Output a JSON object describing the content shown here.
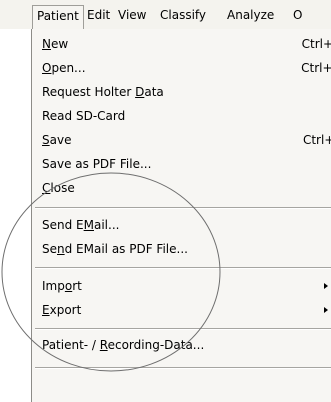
{
  "menubar": {
    "items": [
      {
        "label": "Patient"
      },
      {
        "label": "Edit"
      },
      {
        "label": "View"
      },
      {
        "label": "Classify"
      },
      {
        "label": "Analyze"
      },
      {
        "label": "O"
      }
    ]
  },
  "menu": {
    "new": {
      "pre": "",
      "mn": "N",
      "post": "ew",
      "shortcut": "Ctrl+N"
    },
    "open": {
      "pre": "",
      "mn": "O",
      "post": "pen...",
      "shortcut": "Ctrl+O"
    },
    "request": {
      "pre": "Request Holter ",
      "mn": "D",
      "post": "ata"
    },
    "read": {
      "label": "Read SD-Card"
    },
    "save": {
      "pre": "",
      "mn": "S",
      "post": "ave",
      "shortcut": "Ctrl+S"
    },
    "save_pdf": {
      "label": "Save as PDF File..."
    },
    "close": {
      "pre": "",
      "mn": "C",
      "post": "lose"
    },
    "send_email": {
      "pre": "Send E",
      "mn": "M",
      "post": "ail..."
    },
    "send_email_pdf": {
      "pre": "Se",
      "mn": "n",
      "post": "d EMail as PDF File..."
    },
    "import": {
      "pre": "Imp",
      "mn": "o",
      "post": "rt"
    },
    "export": {
      "pre": "",
      "mn": "E",
      "post": "xport"
    },
    "patient_data": {
      "pre": "Patient- / ",
      "mn": "R",
      "post": "ecording-Data..."
    }
  }
}
